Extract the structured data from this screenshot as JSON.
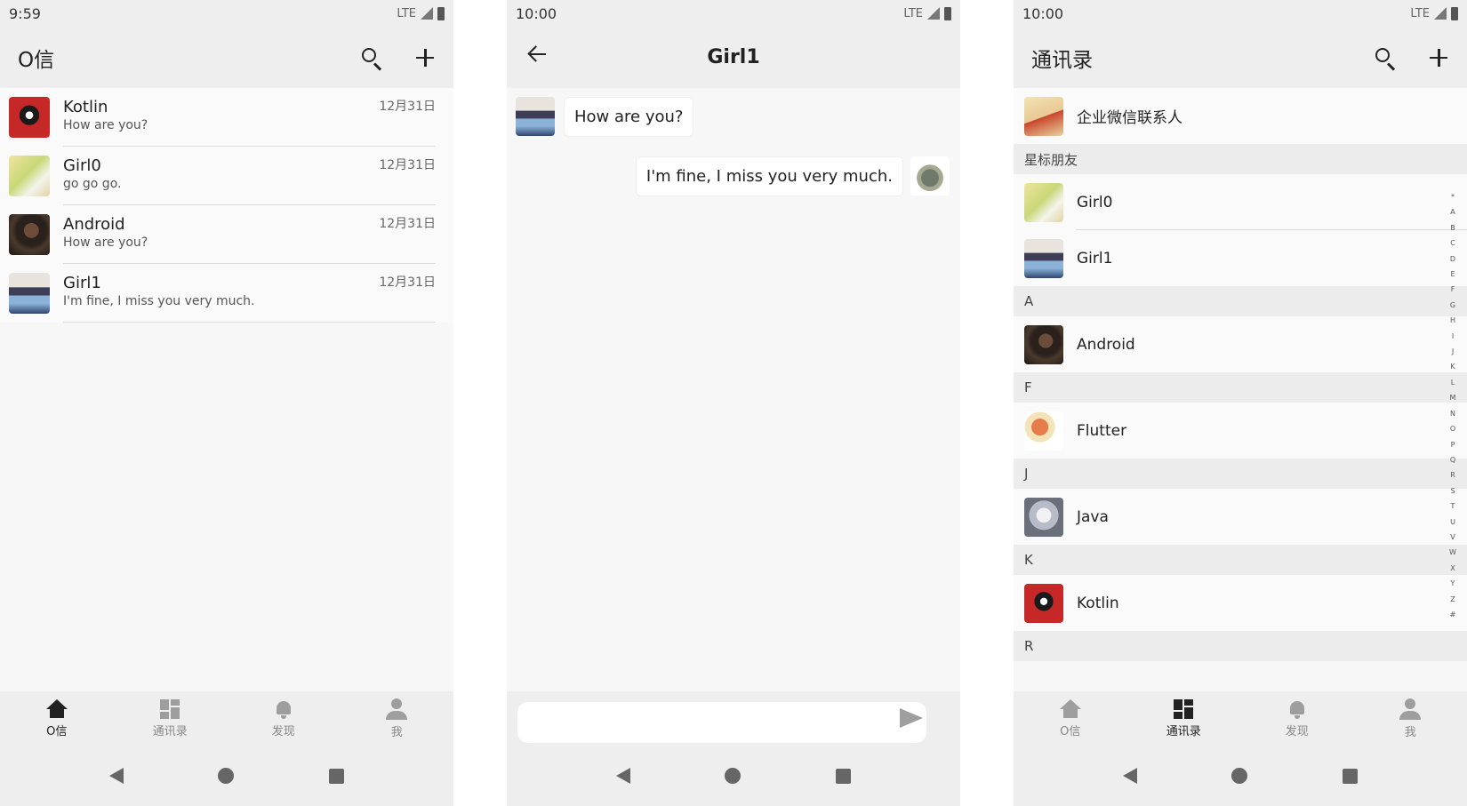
{
  "screens": {
    "messages": {
      "status": {
        "time": "9:59",
        "network": "LTE"
      },
      "title": "O信",
      "chats": [
        {
          "name": "Kotlin",
          "message": "How are you?",
          "time": "12月31日",
          "avatar": "kotlin-avatar"
        },
        {
          "name": "Girl0",
          "message": "go go go.",
          "time": "12月31日",
          "avatar": "girl0-avatar"
        },
        {
          "name": "Android",
          "message": "How are you?",
          "time": "12月31日",
          "avatar": "android-avatar"
        },
        {
          "name": "Girl1",
          "message": "I'm fine, I miss you very much.",
          "time": "12月31日",
          "avatar": "girl1-avatar"
        }
      ]
    },
    "chat": {
      "status": {
        "time": "10:00",
        "network": "LTE"
      },
      "title": "Girl1",
      "messages": [
        {
          "from": "Girl1",
          "text": "How are you?"
        },
        {
          "from": "me",
          "text": "I'm fine, I miss you very much."
        }
      ],
      "input": {
        "value": "",
        "placeholder": ""
      }
    },
    "contacts": {
      "status": {
        "time": "10:00",
        "network": "LTE"
      },
      "title": "通讯录",
      "corp_contacts": "企业微信联系人",
      "sections": [
        {
          "header": "星标朋友",
          "contacts": [
            "Girl0",
            "Girl1"
          ]
        },
        {
          "header": "A",
          "contacts": [
            "Android"
          ]
        },
        {
          "header": "F",
          "contacts": [
            "Flutter"
          ]
        },
        {
          "header": "J",
          "contacts": [
            "Java"
          ]
        },
        {
          "header": "K",
          "contacts": [
            "Kotlin"
          ]
        },
        {
          "header": "R",
          "contacts": []
        }
      ],
      "index_letters": [
        "*",
        "A",
        "B",
        "C",
        "D",
        "E",
        "F",
        "G",
        "H",
        "I",
        "J",
        "K",
        "L",
        "M",
        "N",
        "O",
        "P",
        "Q",
        "R",
        "S",
        "T",
        "U",
        "V",
        "W",
        "X",
        "Y",
        "Z",
        "#"
      ]
    }
  },
  "bottom_nav": [
    {
      "label": "O信",
      "icon": "home-icon"
    },
    {
      "label": "通讯录",
      "icon": "dashboard-icon"
    },
    {
      "label": "发现",
      "icon": "bell-icon"
    },
    {
      "label": "我",
      "icon": "person-icon"
    }
  ],
  "colors": {
    "bar": "#eeeeee",
    "background": "#f7f7f7",
    "active": "#222222",
    "inactive": "#9e9e9e"
  }
}
